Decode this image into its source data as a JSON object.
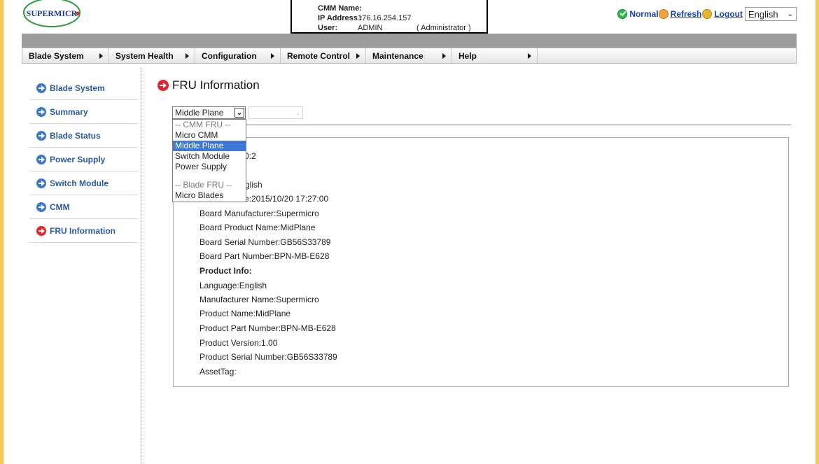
{
  "header": {
    "logo_text": "SUPERMICRO",
    "cmm_name_label": "CMM Name:",
    "cmm_name_value": "",
    "ip_label": "IP Address :",
    "ip_value": "176.16.254.157",
    "user_label": "User:",
    "user_value": "ADMIN",
    "user_role": "( Administrator )",
    "status_text": "Normal",
    "refresh_label": "Refresh",
    "logout_label": "Logout",
    "language": "English"
  },
  "menu": {
    "items": [
      "Blade System",
      "System Health",
      "Configuration",
      "Remote Control",
      "Maintenance",
      "Help"
    ]
  },
  "sidebar": {
    "items": [
      {
        "label": "Blade System",
        "icon": "arrow-right-blue-icon"
      },
      {
        "label": "Summary",
        "icon": "arrow-right-blue-icon"
      },
      {
        "label": "Blade Status",
        "icon": "arrow-right-blue-icon"
      },
      {
        "label": "Power Supply",
        "icon": "arrow-right-blue-icon"
      },
      {
        "label": "Switch Module",
        "icon": "arrow-right-blue-icon"
      },
      {
        "label": "CMM",
        "icon": "arrow-right-blue-icon"
      },
      {
        "label": "FRU Information",
        "icon": "arrow-right-red-icon"
      }
    ]
  },
  "main": {
    "title": "FRU Information",
    "fru_select_value": "Middle Plane",
    "dropdown": {
      "cmm_group": "-- CMM FRU --",
      "options": [
        "Micro CMM",
        "Middle Plane",
        "Switch Module",
        "Power Supply"
      ],
      "blade_group": "-- Blade FRU --",
      "blade_options": [
        "Micro Blades"
      ],
      "selected": "Middle Plane"
    },
    "panel": {
      "partial_line_1": "0:2",
      "partial_line_2": "glish",
      "partial_line_3": "e:2015/10/20 17:27:00",
      "board_manufacturer": "Board Manufacturer:Supermicro",
      "board_product_name": "Board Product Name:MidPlane",
      "board_serial": "Board Serial Number:GB56S33789",
      "board_part": "Board Part Number:BPN-MB-E628",
      "product_info_heading": "Product Info:",
      "language": "Language:English",
      "manufacturer_name": "Manufacturer Name:Supermicro",
      "product_name": "Product Name:MidPlane",
      "product_part": "Product Part Number:BPN-MB-E628",
      "product_version": "Product Version:1.00",
      "product_serial": "Product Serial Number:GB56S33789",
      "asset_tag": "AssetTag:"
    }
  },
  "colors": {
    "link_blue": "#1a44a8",
    "sidebar_blue": "#2a59a6",
    "active_red": "#e0242a",
    "selection_blue": "#3c78d8"
  }
}
